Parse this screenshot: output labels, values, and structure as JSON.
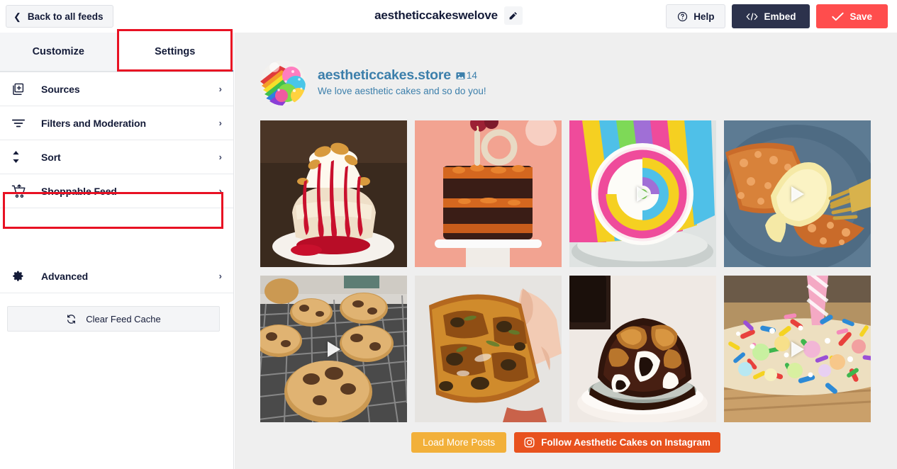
{
  "topbar": {
    "back_label": "Back to all feeds",
    "back_icon": "chevron-left-icon",
    "feed_title": "aestheticcakeswelove",
    "edit_icon": "pencil-icon",
    "help_label": "Help",
    "help_icon": "question-circle-icon",
    "embed_label": "Embed",
    "embed_icon": "code-brackets-icon",
    "save_label": "Save",
    "save_icon": "check-icon",
    "embed_bg": "#2c324c",
    "save_bg": "#ff4d4d"
  },
  "tabs": [
    {
      "label": "Customize",
      "active": false
    },
    {
      "label": "Settings",
      "active": true
    }
  ],
  "highlight_color": "#e81123",
  "menu": {
    "items": [
      {
        "label": "Sources",
        "icon": "add-to-stack-icon",
        "arrow": "›",
        "highlighted": false
      },
      {
        "label": "Filters and Moderation",
        "icon": "filter-icon",
        "arrow": "›",
        "highlighted": false
      },
      {
        "label": "Sort",
        "icon": "sort-updown-icon",
        "arrow": "›",
        "highlighted": false
      },
      {
        "label": "Shoppable Feed",
        "icon": "shopping-cart-icon",
        "arrow": "›",
        "highlighted": true
      },
      {
        "label": "Advanced",
        "icon": "gear-icon",
        "arrow": "›",
        "highlighted": false
      }
    ],
    "clear_cache_label": "Clear Feed Cache",
    "clear_cache_icon": "refresh-icon"
  },
  "preview": {
    "profile": {
      "name": "aestheticcakes.store",
      "photo_count": "14",
      "photo_count_icon": "photo-icon",
      "bio": "We love aesthetic cakes and so do you!",
      "avatar_alt": "rainbow-cake-avatar",
      "link_color": "#3c7fab"
    },
    "tiles": [
      {
        "alt": "strawberry-cream-cake-slice",
        "video": false
      },
      {
        "alt": "chocolate-layer-cake-with-10-candle",
        "video": false
      },
      {
        "alt": "rainbow-swiss-roll-cake",
        "video": true
      },
      {
        "alt": "apple-crumble-slice-on-blue-plate",
        "video": true
      },
      {
        "alt": "chocolate-chip-cookies-on-rack",
        "video": true
      },
      {
        "alt": "zucchini-chocolate-chip-brownie",
        "video": false
      },
      {
        "alt": "chocolate-fudge-dessert-on-plate",
        "video": false
      },
      {
        "alt": "sprinkle-covered-birthday-cake",
        "video": true
      }
    ],
    "load_more_label": "Load More Posts",
    "load_more_bg": "#f2b03a",
    "follow_label": "Follow Aesthetic Cakes on Instagram",
    "follow_icon": "instagram-icon",
    "follow_bg": "#e8521e"
  }
}
